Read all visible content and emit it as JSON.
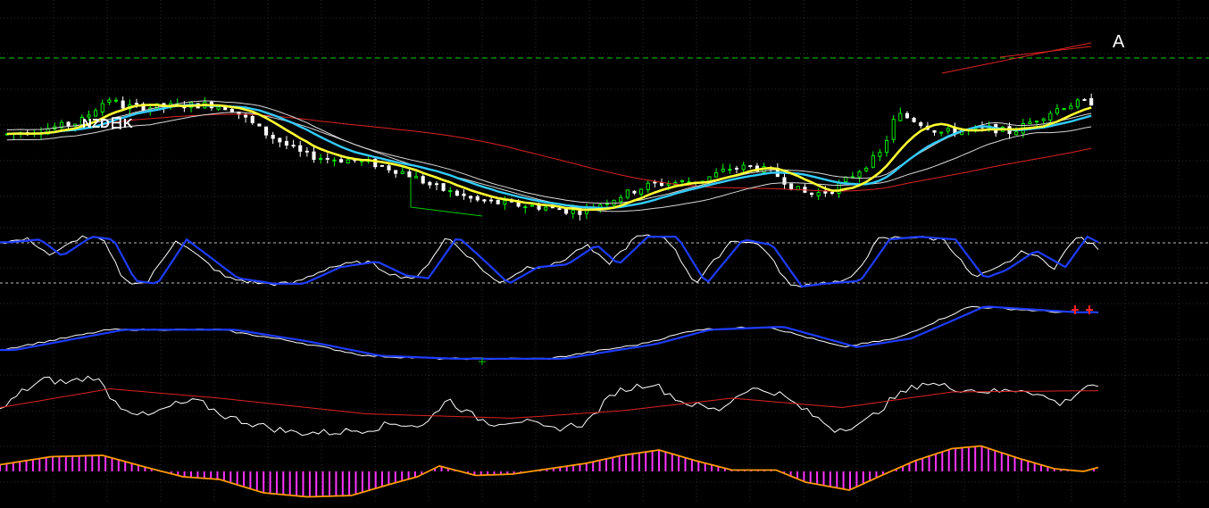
{
  "chart_data": {
    "type": "candlestick",
    "title": "NZD日K",
    "annotation": "A",
    "candle_count": 160,
    "colors": {
      "background": "#000000",
      "grid": "#2e2e2e",
      "up_candle": "#00ff00",
      "down_candle": "#ffffff",
      "ma_yellow": "#ffff33",
      "ma_cyan": "#33ccff",
      "ma_white": "#d8d8d8",
      "ma_red": "#dd2222",
      "reference_line": "#00cc00",
      "trendline_red": "#dd2222",
      "trendline_green": "#00cc00",
      "k_line": "#ffffff",
      "d_line": "#1f3cff",
      "indicator_red": "#dd2222",
      "macd_bar": "#ff33ff",
      "macd_signal": "#ff9900",
      "marker_red": "#ff2222"
    },
    "price_points": [
      [
        0,
        0.42
      ],
      [
        10,
        0.445
      ],
      [
        20,
        0.48
      ],
      [
        28,
        0.6
      ],
      [
        32,
        0.56
      ],
      [
        40,
        0.555
      ],
      [
        50,
        0.565
      ],
      [
        56,
        0.57
      ],
      [
        62,
        0.55
      ],
      [
        72,
        0.42
      ],
      [
        82,
        0.32
      ],
      [
        88,
        0.3
      ],
      [
        96,
        0.29
      ],
      [
        102,
        0.27
      ],
      [
        110,
        0.23
      ],
      [
        118,
        0.16
      ],
      [
        130,
        0.09
      ],
      [
        140,
        0.07
      ],
      [
        150,
        0.055
      ],
      [
        155,
        0.04
      ],
      [
        158,
        0.035
      ],
      [
        165,
        0.08
      ],
      [
        172,
        0.13
      ],
      [
        178,
        0.17
      ],
      [
        185,
        0.18
      ],
      [
        192,
        0.19
      ],
      [
        200,
        0.25
      ],
      [
        206,
        0.26
      ],
      [
        212,
        0.23
      ],
      [
        218,
        0.15
      ],
      [
        222,
        0.12
      ],
      [
        228,
        0.14
      ],
      [
        235,
        0.23
      ],
      [
        242,
        0.33
      ],
      [
        246,
        0.52
      ],
      [
        250,
        0.5
      ],
      [
        258,
        0.43
      ],
      [
        266,
        0.44
      ],
      [
        272,
        0.45
      ],
      [
        278,
        0.43
      ],
      [
        284,
        0.49
      ],
      [
        292,
        0.56
      ],
      [
        296,
        0.575
      ],
      [
        300,
        0.58
      ]
    ],
    "stochastic_points": [
      [
        0,
        0.85
      ],
      [
        8,
        0.9
      ],
      [
        14,
        0.6
      ],
      [
        22,
        0.95
      ],
      [
        28,
        0.9
      ],
      [
        34,
        0.15
      ],
      [
        40,
        0.1
      ],
      [
        48,
        0.9
      ],
      [
        54,
        0.6
      ],
      [
        62,
        0.2
      ],
      [
        72,
        0.1
      ],
      [
        80,
        0.1
      ],
      [
        90,
        0.4
      ],
      [
        100,
        0.5
      ],
      [
        108,
        0.25
      ],
      [
        114,
        0.2
      ],
      [
        122,
        0.95
      ],
      [
        128,
        0.6
      ],
      [
        136,
        0.1
      ],
      [
        144,
        0.4
      ],
      [
        152,
        0.45
      ],
      [
        160,
        0.8
      ],
      [
        166,
        0.45
      ],
      [
        174,
        0.95
      ],
      [
        182,
        0.95
      ],
      [
        190,
        0.1
      ],
      [
        200,
        0.9
      ],
      [
        208,
        0.8
      ],
      [
        216,
        0.05
      ],
      [
        222,
        0.1
      ],
      [
        232,
        0.15
      ],
      [
        240,
        0.9
      ],
      [
        248,
        0.95
      ],
      [
        258,
        0.9
      ],
      [
        266,
        0.2
      ],
      [
        272,
        0.35
      ],
      [
        280,
        0.7
      ],
      [
        288,
        0.4
      ],
      [
        294,
        0.95
      ],
      [
        300,
        0.75
      ]
    ],
    "trend_points": [
      [
        0,
        0.2
      ],
      [
        30,
        0.55
      ],
      [
        60,
        0.55
      ],
      [
        80,
        0.35
      ],
      [
        100,
        0.1
      ],
      [
        120,
        0.05
      ],
      [
        150,
        0.05
      ],
      [
        175,
        0.3
      ],
      [
        190,
        0.55
      ],
      [
        210,
        0.6
      ],
      [
        230,
        0.25
      ],
      [
        245,
        0.4
      ],
      [
        265,
        0.95
      ],
      [
        290,
        0.85
      ],
      [
        300,
        0.85
      ]
    ],
    "momentum_points": [
      [
        0,
        0.4
      ],
      [
        6,
        0.7
      ],
      [
        12,
        0.9
      ],
      [
        18,
        0.85
      ],
      [
        26,
        0.95
      ],
      [
        32,
        0.5
      ],
      [
        40,
        0.3
      ],
      [
        48,
        0.5
      ],
      [
        54,
        0.55
      ],
      [
        62,
        0.3
      ],
      [
        72,
        0.15
      ],
      [
        80,
        0.05
      ],
      [
        90,
        0.05
      ],
      [
        100,
        0.1
      ],
      [
        108,
        0.2
      ],
      [
        116,
        0.15
      ],
      [
        122,
        0.6
      ],
      [
        128,
        0.35
      ],
      [
        134,
        0.2
      ],
      [
        142,
        0.25
      ],
      [
        150,
        0.1
      ],
      [
        160,
        0.2
      ],
      [
        168,
        0.7
      ],
      [
        178,
        0.85
      ],
      [
        186,
        0.55
      ],
      [
        196,
        0.4
      ],
      [
        204,
        0.75
      ],
      [
        212,
        0.7
      ],
      [
        220,
        0.4
      ],
      [
        228,
        0.1
      ],
      [
        236,
        0.2
      ],
      [
        244,
        0.6
      ],
      [
        252,
        0.85
      ],
      [
        262,
        0.75
      ],
      [
        272,
        0.7
      ],
      [
        280,
        0.75
      ],
      [
        290,
        0.5
      ],
      [
        298,
        0.85
      ],
      [
        300,
        0.75
      ]
    ],
    "macd_points": [
      [
        0,
        0.25
      ],
      [
        14,
        0.55
      ],
      [
        28,
        0.6
      ],
      [
        40,
        0.15
      ],
      [
        50,
        -0.2
      ],
      [
        60,
        -0.3
      ],
      [
        72,
        -0.8
      ],
      [
        84,
        -0.95
      ],
      [
        96,
        -0.9
      ],
      [
        106,
        -0.5
      ],
      [
        114,
        -0.2
      ],
      [
        120,
        0.2
      ],
      [
        130,
        -0.15
      ],
      [
        140,
        -0.1
      ],
      [
        150,
        0.1
      ],
      [
        160,
        0.3
      ],
      [
        170,
        0.6
      ],
      [
        180,
        0.8
      ],
      [
        190,
        0.4
      ],
      [
        200,
        0.05
      ],
      [
        212,
        0.05
      ],
      [
        220,
        -0.4
      ],
      [
        232,
        -0.7
      ],
      [
        240,
        -0.2
      ],
      [
        250,
        0.4
      ],
      [
        260,
        0.85
      ],
      [
        268,
        0.95
      ],
      [
        278,
        0.5
      ],
      [
        288,
        0.1
      ],
      [
        296,
        0.0
      ],
      [
        300,
        0.15
      ]
    ],
    "red_markers": 2
  }
}
